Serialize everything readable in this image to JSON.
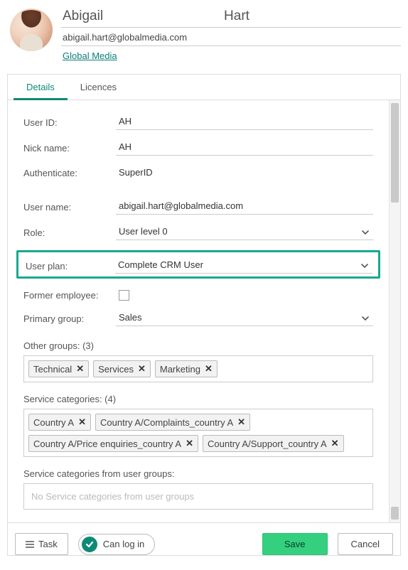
{
  "header": {
    "first_name": "Abigail",
    "last_name": "Hart",
    "email": "abigail.hart@globalmedia.com",
    "company": "Global Media"
  },
  "tabs": {
    "details": "Details",
    "licences": "Licences"
  },
  "fields": {
    "user_id_label": "User ID:",
    "user_id_value": "AH",
    "nick_name_label": "Nick name:",
    "nick_name_value": "AH",
    "authenticate_label": "Authenticate:",
    "authenticate_value": "SuperID",
    "user_name_label": "User name:",
    "user_name_value": "abigail.hart@globalmedia.com",
    "role_label": "Role:",
    "role_value": "User level 0",
    "user_plan_label": "User plan:",
    "user_plan_value": "Complete CRM User",
    "former_employee_label": "Former employee:",
    "primary_group_label": "Primary group:",
    "primary_group_value": "Sales"
  },
  "other_groups": {
    "label": "Other groups: (3)",
    "chips": [
      "Technical",
      "Services",
      "Marketing"
    ]
  },
  "service_categories": {
    "label": "Service categories: (4)",
    "chips": [
      "Country A",
      "Country A/Complaints_country A",
      "Country A/Price enquiries_country A",
      "Country A/Support_country A"
    ]
  },
  "service_categories_from_groups": {
    "label": "Service categories from user groups:",
    "placeholder": "No Service categories from user groups"
  },
  "footer": {
    "task": "Task",
    "can_log_in": "Can log in",
    "save": "Save",
    "cancel": "Cancel"
  }
}
